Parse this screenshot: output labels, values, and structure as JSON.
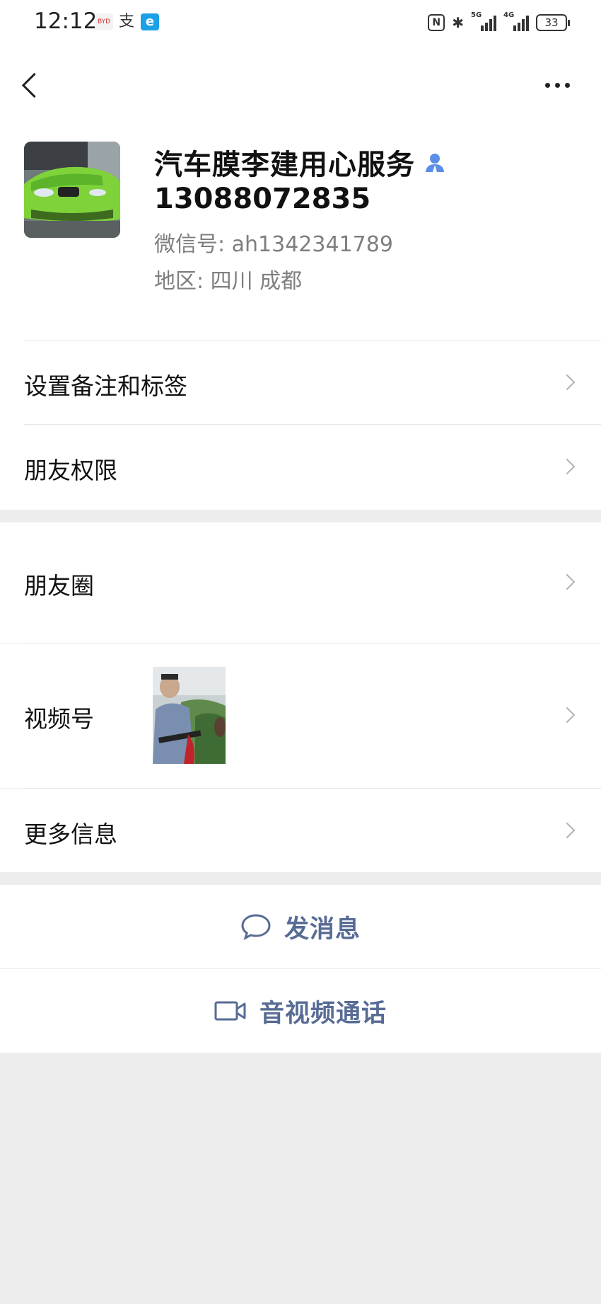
{
  "status_bar": {
    "time": "12:12",
    "battery": "33",
    "network_1": "5G",
    "network_2": "4G"
  },
  "profile": {
    "name": "汽车膜李建用心服务",
    "phone": "13088072835",
    "wechat_id": "微信号:  ah1342341789",
    "region": "地区:  四川  成都"
  },
  "menu": {
    "set_remark": "设置备注和标签",
    "friend_permissions": "朋友权限",
    "moments": "朋友圈",
    "channels": "视频号",
    "more_info": "更多信息"
  },
  "actions": {
    "send_message": "发消息",
    "video_call": "音视频通话"
  },
  "colors": {
    "link_blue": "#576b95",
    "verified_icon": "#5b8ee6",
    "background": "#ededed"
  }
}
